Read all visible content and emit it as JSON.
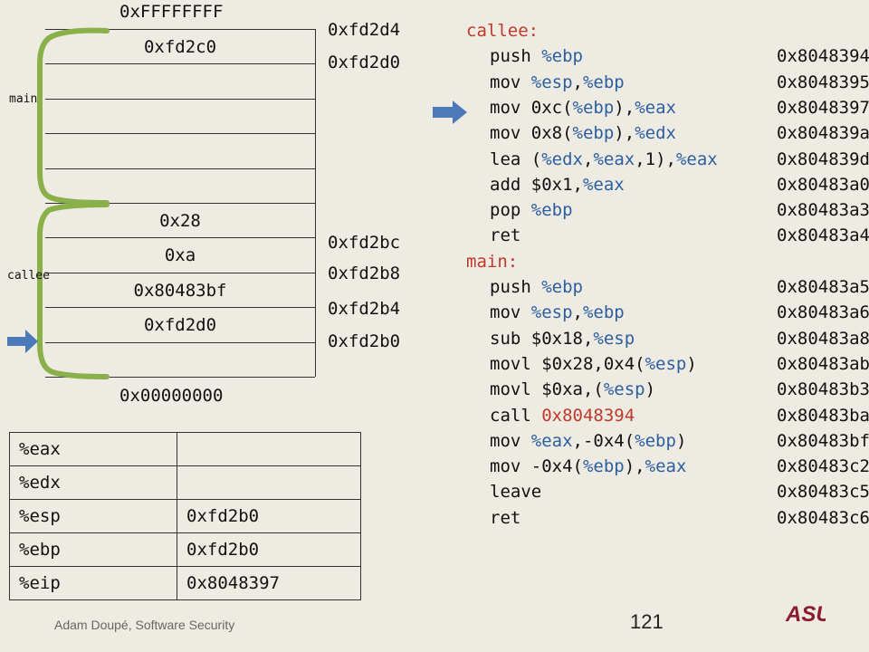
{
  "stack": {
    "top_label": "0xFFFFFFFF",
    "bottom_label": "0x00000000",
    "cells": [
      "0xfd2c0",
      "",
      "",
      "",
      "",
      "0x28",
      "0xa",
      "0x80483bf",
      "0xfd2d0",
      ""
    ],
    "addresses": [
      "0xfd2d4",
      "0xfd2d0",
      "0xfd2bc",
      "0xfd2b8",
      "0xfd2b4",
      "0xfd2b0"
    ],
    "main_label": "main",
    "callee_label": "callee"
  },
  "registers": [
    {
      "name": "%eax",
      "value": ""
    },
    {
      "name": "%edx",
      "value": ""
    },
    {
      "name": "%esp",
      "value": "0xfd2b0"
    },
    {
      "name": "%ebp",
      "value": "0xfd2b0"
    },
    {
      "name": "%eip",
      "value": "0x8048397"
    }
  ],
  "assembly": {
    "callee_label": "callee:",
    "main_label": "main:",
    "callee": [
      {
        "op": "push ",
        "args": [
          [
            "reg",
            "%ebp"
          ]
        ],
        "addr": "0x8048394"
      },
      {
        "op": "mov ",
        "args": [
          [
            "reg",
            "%esp"
          ],
          [
            "txt",
            ","
          ],
          [
            "reg",
            "%ebp"
          ]
        ],
        "addr": "0x8048395"
      },
      {
        "op": "mov ",
        "args": [
          [
            "txt",
            "0xc("
          ],
          [
            "reg",
            "%ebp"
          ],
          [
            "txt",
            "),"
          ],
          [
            "reg",
            "%eax"
          ]
        ],
        "addr": "0x8048397"
      },
      {
        "op": "mov ",
        "args": [
          [
            "txt",
            "0x8("
          ],
          [
            "reg",
            "%ebp"
          ],
          [
            "txt",
            "),"
          ],
          [
            "reg",
            "%edx"
          ]
        ],
        "addr": "0x804839a"
      },
      {
        "op": "lea ",
        "args": [
          [
            "txt",
            "("
          ],
          [
            "reg",
            "%edx"
          ],
          [
            "txt",
            ","
          ],
          [
            "reg",
            "%eax"
          ],
          [
            "txt",
            ",1),"
          ],
          [
            "reg",
            "%eax"
          ]
        ],
        "addr": "0x804839d"
      },
      {
        "op": "add ",
        "args": [
          [
            "txt",
            "$0x1,"
          ],
          [
            "reg",
            "%eax"
          ]
        ],
        "addr": "0x80483a0"
      },
      {
        "op": "pop ",
        "args": [
          [
            "reg",
            "%ebp"
          ]
        ],
        "addr": "0x80483a3"
      },
      {
        "op": "ret",
        "args": [],
        "addr": "0x80483a4"
      }
    ],
    "main": [
      {
        "op": "push ",
        "args": [
          [
            "reg",
            "%ebp"
          ]
        ],
        "addr": "0x80483a5"
      },
      {
        "op": "mov ",
        "args": [
          [
            "reg",
            "%esp"
          ],
          [
            "txt",
            ","
          ],
          [
            "reg",
            "%ebp"
          ]
        ],
        "addr": "0x80483a6"
      },
      {
        "op": "sub ",
        "args": [
          [
            "txt",
            "$0x18,"
          ],
          [
            "reg",
            "%esp"
          ]
        ],
        "addr": "0x80483a8"
      },
      {
        "op": "movl ",
        "args": [
          [
            "txt",
            "$0x28,0x4("
          ],
          [
            "reg",
            "%esp"
          ],
          [
            "txt",
            ")"
          ]
        ],
        "addr": "0x80483ab"
      },
      {
        "op": "movl ",
        "args": [
          [
            "txt",
            "$0xa,("
          ],
          [
            "reg",
            "%esp"
          ],
          [
            "txt",
            ")"
          ]
        ],
        "addr": "0x80483b3"
      },
      {
        "op": "call ",
        "args": [
          [
            "hex",
            "0x8048394"
          ]
        ],
        "addr": "0x80483ba"
      },
      {
        "op": "mov ",
        "args": [
          [
            "reg",
            "%eax"
          ],
          [
            "txt",
            ",-0x4("
          ],
          [
            "reg",
            "%ebp"
          ],
          [
            "txt",
            ")"
          ]
        ],
        "addr": "0x80483bf"
      },
      {
        "op": "mov ",
        "args": [
          [
            "txt",
            "-0x4("
          ],
          [
            "reg",
            "%ebp"
          ],
          [
            "txt",
            "),"
          ],
          [
            "reg",
            "%eax"
          ]
        ],
        "addr": "0x80483c2"
      },
      {
        "op": "leave",
        "args": [],
        "addr": "0x80483c5"
      },
      {
        "op": "ret",
        "args": [],
        "addr": "0x80483c6"
      }
    ]
  },
  "footer": {
    "author": "Adam Doupé, Software Security",
    "page": "121",
    "logo_text": "ASU"
  },
  "colors": {
    "background": "#eeebe3",
    "bracket": "#8ab04a",
    "arrow": "#4a7ab8",
    "register_text": "#2c5fa0",
    "label_text": "#c0392b"
  }
}
